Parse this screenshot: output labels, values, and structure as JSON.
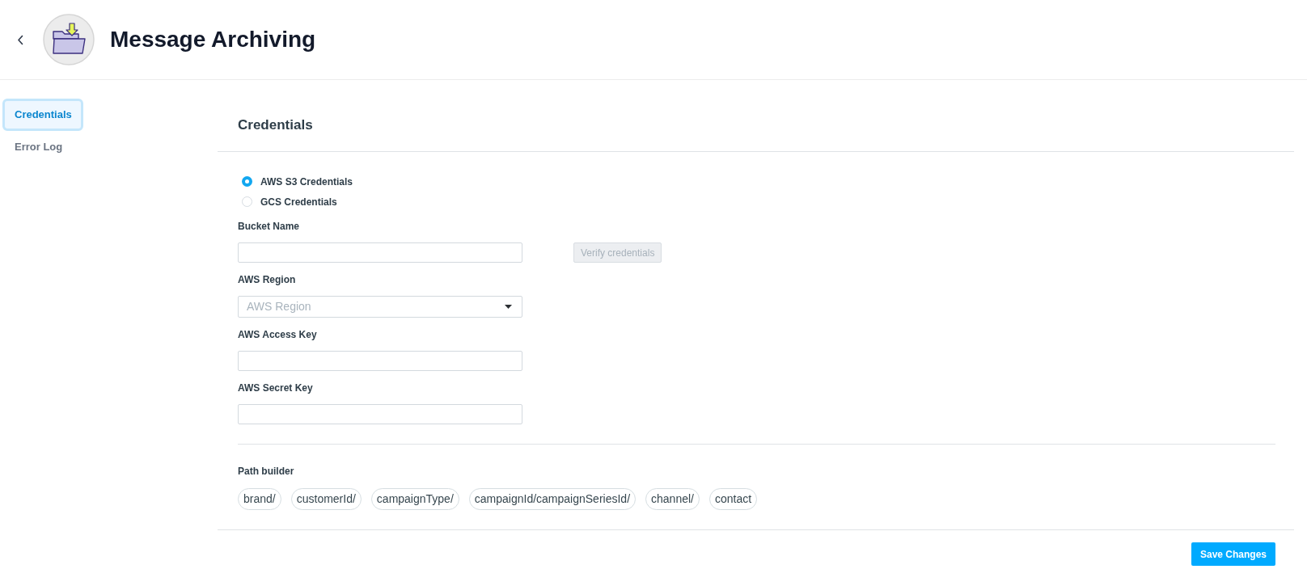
{
  "header": {
    "title": "Message Archiving"
  },
  "sidebar": {
    "items": [
      {
        "label": "Credentials",
        "selected": true
      },
      {
        "label": "Error Log",
        "selected": false
      }
    ]
  },
  "panel": {
    "title": "Credentials",
    "credential_types": [
      {
        "label": "AWS S3 Credentials",
        "selected": true
      },
      {
        "label": "GCS Credentials",
        "selected": false
      }
    ],
    "fields": [
      {
        "kind": "text",
        "label": "Bucket Name",
        "button": {
          "label": "Verify credentials",
          "disabled": true
        }
      },
      {
        "kind": "select",
        "label": "AWS Region",
        "placeholder": "AWS Region"
      },
      {
        "kind": "text",
        "label": "AWS Access Key"
      },
      {
        "kind": "text",
        "label": "AWS Secret Key"
      }
    ],
    "path_builder": {
      "label": "Path builder",
      "segments": [
        "brand/",
        "customerId/",
        "campaignType/",
        "campaignId/campaignSeriesId/",
        "channel/",
        "contact"
      ]
    },
    "save_button": {
      "label": "Save Changes"
    }
  }
}
